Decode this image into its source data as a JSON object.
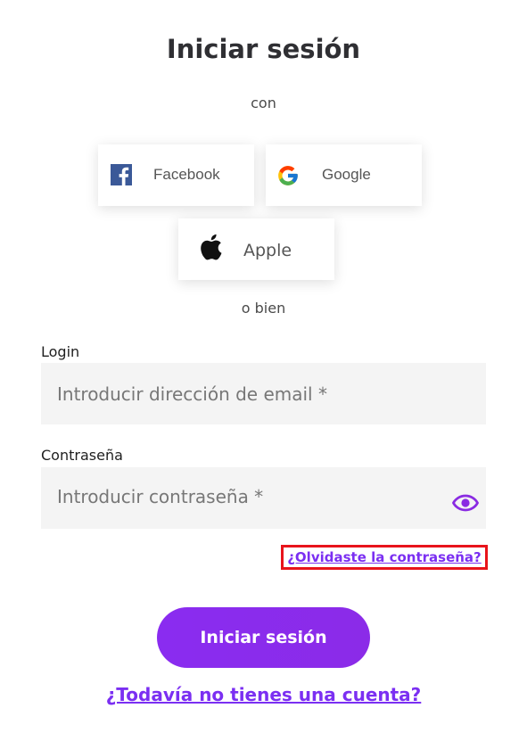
{
  "title": "Iniciar sesión",
  "with_text": "con",
  "social": {
    "facebook": {
      "label": "Facebook",
      "icon": "facebook-icon",
      "color": "#3b5998"
    },
    "google": {
      "label": "Google",
      "icon": "google-icon"
    },
    "apple": {
      "label": "Apple",
      "icon": "apple-icon",
      "color": "#000000"
    }
  },
  "or_text": "o bien",
  "login": {
    "label": "Login",
    "placeholder": "Introducir dirección de email *",
    "value": ""
  },
  "password": {
    "label": "Contraseña",
    "placeholder": "Introducir contraseña *",
    "value": "",
    "toggle_icon": "eye-icon"
  },
  "forgot_link": "¿Olvidaste la contraseña?",
  "submit_label": "Iniciar sesión",
  "register_link": "¿Todavía no tienes una cuenta?",
  "colors": {
    "accent": "#8a2be2",
    "link": "#7b2ff2",
    "highlight_border": "#e8141b",
    "input_bg": "#f4f4f4"
  }
}
